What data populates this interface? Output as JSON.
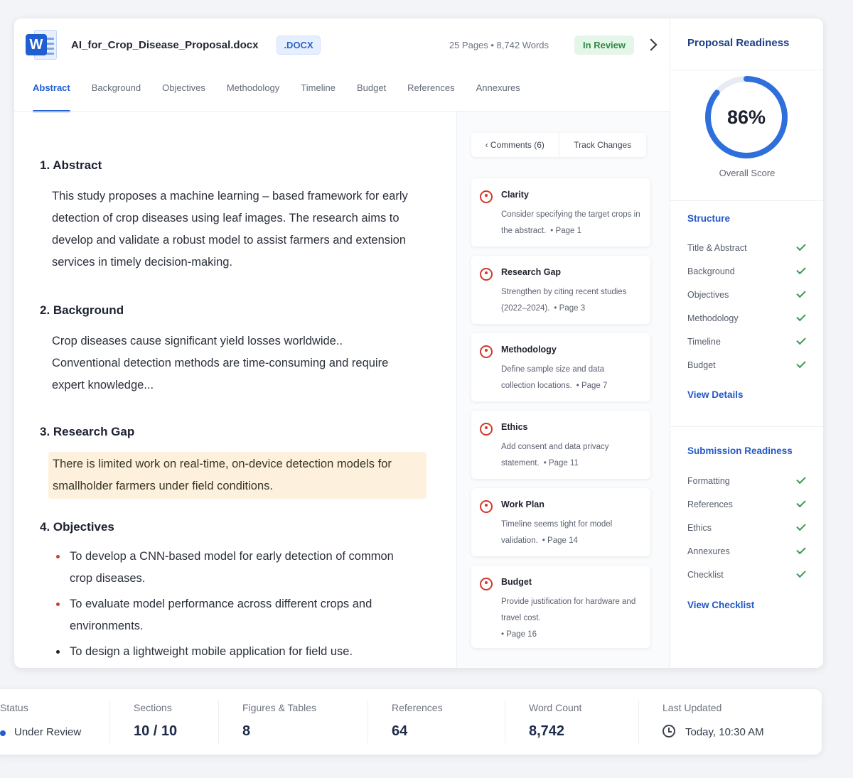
{
  "header": {
    "file_name": "AI_for_Crop_Disease_Proposal.docx",
    "file_ext": ".DOCX",
    "meta": "25 Pages • 8,742 Words",
    "status_badge": "In Review",
    "app_icon_letter": "W"
  },
  "tabs": [
    "Abstract",
    "Background",
    "Objectives",
    "Methodology",
    "Timeline",
    "Budget",
    "References",
    "Annexures"
  ],
  "document": {
    "abstract": {
      "heading": "1. Abstract",
      "text": "This study proposes a machine learning – based framework for early detection of crop diseases using leaf images. The research aims to develop and validate a robust model to assist farmers and extension services in timely decision-making."
    },
    "background": {
      "heading": "2. Background",
      "text": "Crop diseases cause significant yield losses worldwide.. Conventional detection methods are time-consuming and require expert knowledge..."
    },
    "research_gap": {
      "heading": "3. Research Gap",
      "text": "There is limited work on real-time, on-device detection models for smallholder farmers under field conditions."
    },
    "objectives": {
      "heading": "4. Objectives",
      "items": [
        "To develop a CNN-based model for early detection of common crop diseases.",
        "To evaluate model performance across different crops and environments.",
        "To design a lightweight mobile application for field use."
      ]
    }
  },
  "comments_panel": {
    "comments_tab": "‹ Comments (6)",
    "track_changes_tab": "Track Changes",
    "comments": [
      {
        "title": "Clarity",
        "text": "Consider specifying the target crops in the abstract.",
        "page": "• Page 1"
      },
      {
        "title": "Research Gap",
        "text": "Strengthen by citing recent studies (2022–2024).",
        "page": "• Page 3"
      },
      {
        "title": "Methodology",
        "text": "Define sample size and data collection locations.",
        "page": "• Page 7"
      },
      {
        "title": "Ethics",
        "text": "Add consent and data privacy statement.",
        "page": "• Page 11"
      },
      {
        "title": "Work Plan",
        "text": "Timeline seems tight for model validation.",
        "page": "• Page 14"
      },
      {
        "title": "Budget",
        "text": "Provide justification for hardware and travel cost.",
        "page": "• Page 16"
      }
    ]
  },
  "readiness": {
    "title": "Proposal Readiness",
    "score": 86,
    "score_text": "86%",
    "score_label": "Overall Score",
    "structure_title": "Structure",
    "structure_items": [
      "Title & Abstract",
      "Background",
      "Objectives",
      "Methodology",
      "Timeline",
      "Budget"
    ],
    "view_details": "View Details",
    "submission_title": "Submission Readiness",
    "submission_items": [
      "Formatting",
      "References",
      "Ethics",
      "Annexures",
      "Checklist"
    ],
    "view_checklist": "View Checklist",
    "accent_color": "#2f6fdc"
  },
  "stats": {
    "status_label": "Status",
    "status_value": "Under Review",
    "sections_label": "Sections",
    "sections_value": "10 / 10",
    "figures_label": "Figures & Tables",
    "figures_value": "8",
    "references_label": "References",
    "references_value": "64",
    "wordcount_label": "Word Count",
    "wordcount_value": "8,742",
    "updated_label": "Last Updated",
    "updated_value": "Today, 10:30 AM"
  }
}
